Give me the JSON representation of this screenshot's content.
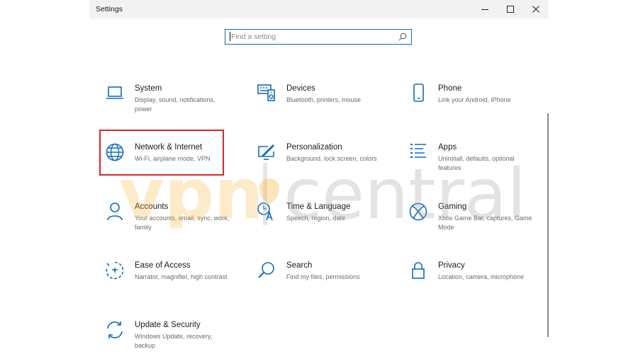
{
  "window": {
    "title": "Settings",
    "controls": {
      "minimize": "minimize",
      "maximize": "maximize",
      "close": "close"
    }
  },
  "search": {
    "placeholder": "Find a setting"
  },
  "accent_color": "#0f6cbd",
  "highlight_color": "#e02424",
  "categories": [
    {
      "name": "System",
      "description": "Display, sound, notifications, power",
      "icon": "laptop-icon"
    },
    {
      "name": "Devices",
      "description": "Bluetooth, printers, mouse",
      "icon": "keyboard-speaker-icon"
    },
    {
      "name": "Phone",
      "description": "Link your Android, iPhone",
      "icon": "phone-icon"
    },
    {
      "name": "Network & Internet",
      "description": "Wi-Fi, airplane mode, VPN",
      "icon": "globe-icon",
      "highlighted": true
    },
    {
      "name": "Personalization",
      "description": "Background, lock screen, colors",
      "icon": "paint-monitor-icon"
    },
    {
      "name": "Apps",
      "description": "Uninstall, defaults, optional features",
      "icon": "apps-list-icon"
    },
    {
      "name": "Accounts",
      "description": "Your accounts, email, sync, work, family",
      "icon": "person-icon"
    },
    {
      "name": "Time & Language",
      "description": "Speech, region, date",
      "icon": "time-language-icon"
    },
    {
      "name": "Gaming",
      "description": "Xbox Game Bar, captures, Game Mode",
      "icon": "xbox-icon"
    },
    {
      "name": "Ease of Access",
      "description": "Narrator, magnifier, high contrast",
      "icon": "ease-of-access-icon"
    },
    {
      "name": "Search",
      "description": "Find my files, permissions",
      "icon": "magnifier-icon"
    },
    {
      "name": "Privacy",
      "description": "Location, camera, microphone",
      "icon": "lock-icon"
    },
    {
      "name": "Update & Security",
      "description": "Windows Update, recovery, backup",
      "icon": "update-arrows-icon"
    }
  ],
  "watermark": {
    "brand": "vpncentral",
    "text_left": "vpn",
    "text_right": "central",
    "color_left": "#f7b538",
    "color_right": "#9a9a9a"
  }
}
